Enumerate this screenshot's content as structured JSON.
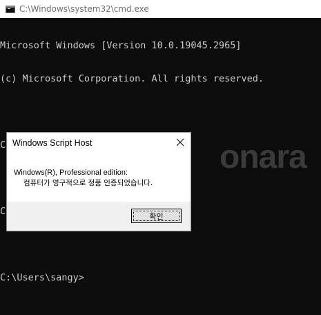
{
  "titlebar": {
    "title": "C:\\Windows\\system32\\cmd.exe"
  },
  "console": {
    "lines": [
      "Microsoft Windows [Version 10.0.19045.2965]",
      "(c) Microsoft Corporation. All rights reserved.",
      "",
      "C:\\Users\\sangy>slmgr/xpr",
      "",
      "C:\\Users\\sangy>slmgr/xpr",
      "",
      "C:\\Users\\sangy>"
    ]
  },
  "watermark": "onara",
  "dialog": {
    "title": "Windows Script Host",
    "message_line1": "Windows(R), Professional edition:",
    "message_line2": "컴퓨터가 영구적으로 정품 인증되었습니다.",
    "ok_label": "확인"
  },
  "colors": {
    "console_bg": "#0c0c0c",
    "console_text": "#cccccc",
    "titlebar_bg": "#ffffff",
    "dialog_footer_bg": "#f0f0f0"
  },
  "icons": {
    "app_icon": "cmd-icon",
    "close": "close-icon"
  }
}
